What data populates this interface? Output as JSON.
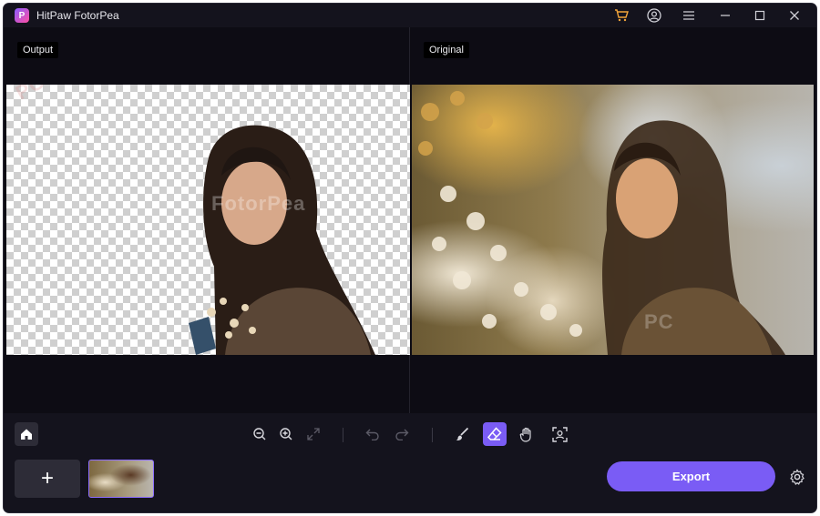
{
  "app": {
    "title": "HitPaw FotorPea",
    "logo_letter": "P"
  },
  "titlebar": {
    "icons": [
      "cart-icon",
      "account-icon",
      "menu-icon",
      "minimize-icon",
      "maximize-icon",
      "close-icon"
    ]
  },
  "canvas": {
    "output_label": "Output",
    "original_label": "Original",
    "watermarks": [
      "PC",
      "FotorPea",
      "PC"
    ]
  },
  "toolbar": {
    "tools": [
      "home-icon",
      "zoom-out-icon",
      "zoom-in-icon",
      "fit-screen-icon",
      "undo-icon",
      "redo-icon",
      "brush-icon",
      "eraser-icon",
      "hand-icon",
      "preview-icon"
    ],
    "active_tool": "eraser-icon",
    "add_label": "+",
    "export_label": "Export"
  },
  "colors": {
    "accent": "#7a5cf5",
    "background": "#14131d",
    "canvas": "#0d0c14"
  }
}
